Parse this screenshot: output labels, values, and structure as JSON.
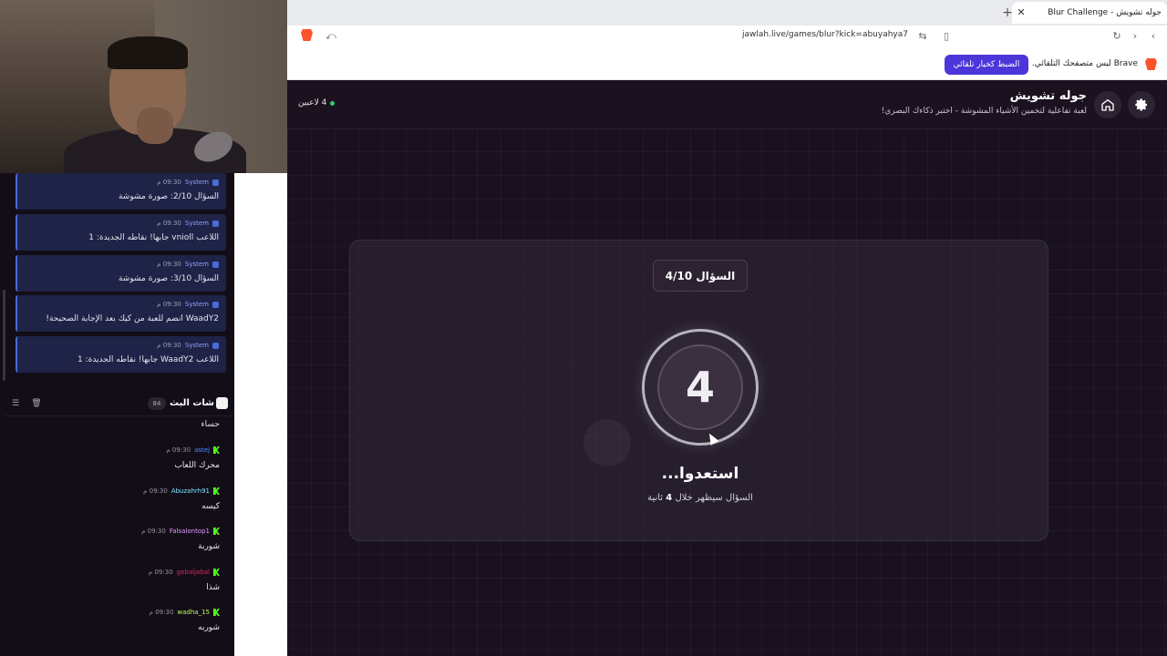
{
  "browser": {
    "tab_title": "جوله تشويش - Blur Challenge",
    "url": "jawlah.live/games/blur?kick=abuyahya7",
    "info_text": "Brave ليس متصفحك التلقائي.",
    "set_default_label": "الضبط كخيار تلقائي"
  },
  "app": {
    "title": "جوله تشويش",
    "subtitle": "لعبة تفاعلية لتخمين الأشياء المشوشة - اختبر ذكاءك البصري!",
    "players": "4 لاعبين",
    "question_badge": "السؤال 4/10",
    "countdown": "4",
    "ready_text": "استعدوا...",
    "next_prefix": "السؤال سيظهر خلال",
    "next_seconds": "4",
    "next_suffix": "ثانية"
  },
  "system_messages": [
    {
      "sender": "System",
      "time": "09:30 م",
      "text": "السؤال 2/10: صورة مشوشة"
    },
    {
      "sender": "System",
      "time": "09:30 م",
      "text": "اللاعب vnioll جابها! نقاطه الجديدة: 1"
    },
    {
      "sender": "System",
      "time": "09:30 م",
      "text": "السؤال 3/10: صورة مشوشة"
    },
    {
      "sender": "System",
      "time": "09:30 م",
      "text": "WaadY2 انضم للعبة من كيك بعد الإجابة الصحيحة!"
    },
    {
      "sender": "System",
      "time": "09:30 م",
      "text": "اللاعب WaadY2 جابها! نقاطه الجديدة: 1"
    }
  ],
  "chat": {
    "title": "شات البث",
    "count": "84",
    "partial_text": "حساء",
    "messages": [
      {
        "user": "astej",
        "time": "09:30 م",
        "text": "محرك اللعاب",
        "color": "#4f8cff"
      },
      {
        "user": "Abuzahrh91",
        "time": "09:30 م",
        "text": "كيسه",
        "color": "#7fe3ff"
      },
      {
        "user": "Falsalontop1",
        "time": "09:30 م",
        "text": "شوربة",
        "color": "#e39cff"
      },
      {
        "user": "gebaljabal",
        "time": "09:30 م",
        "text": "شذا",
        "color": "#e0245e"
      },
      {
        "user": "wadha_15",
        "time": "09:30 م",
        "text": "شوربه",
        "color": "#b6ff5a"
      }
    ]
  }
}
